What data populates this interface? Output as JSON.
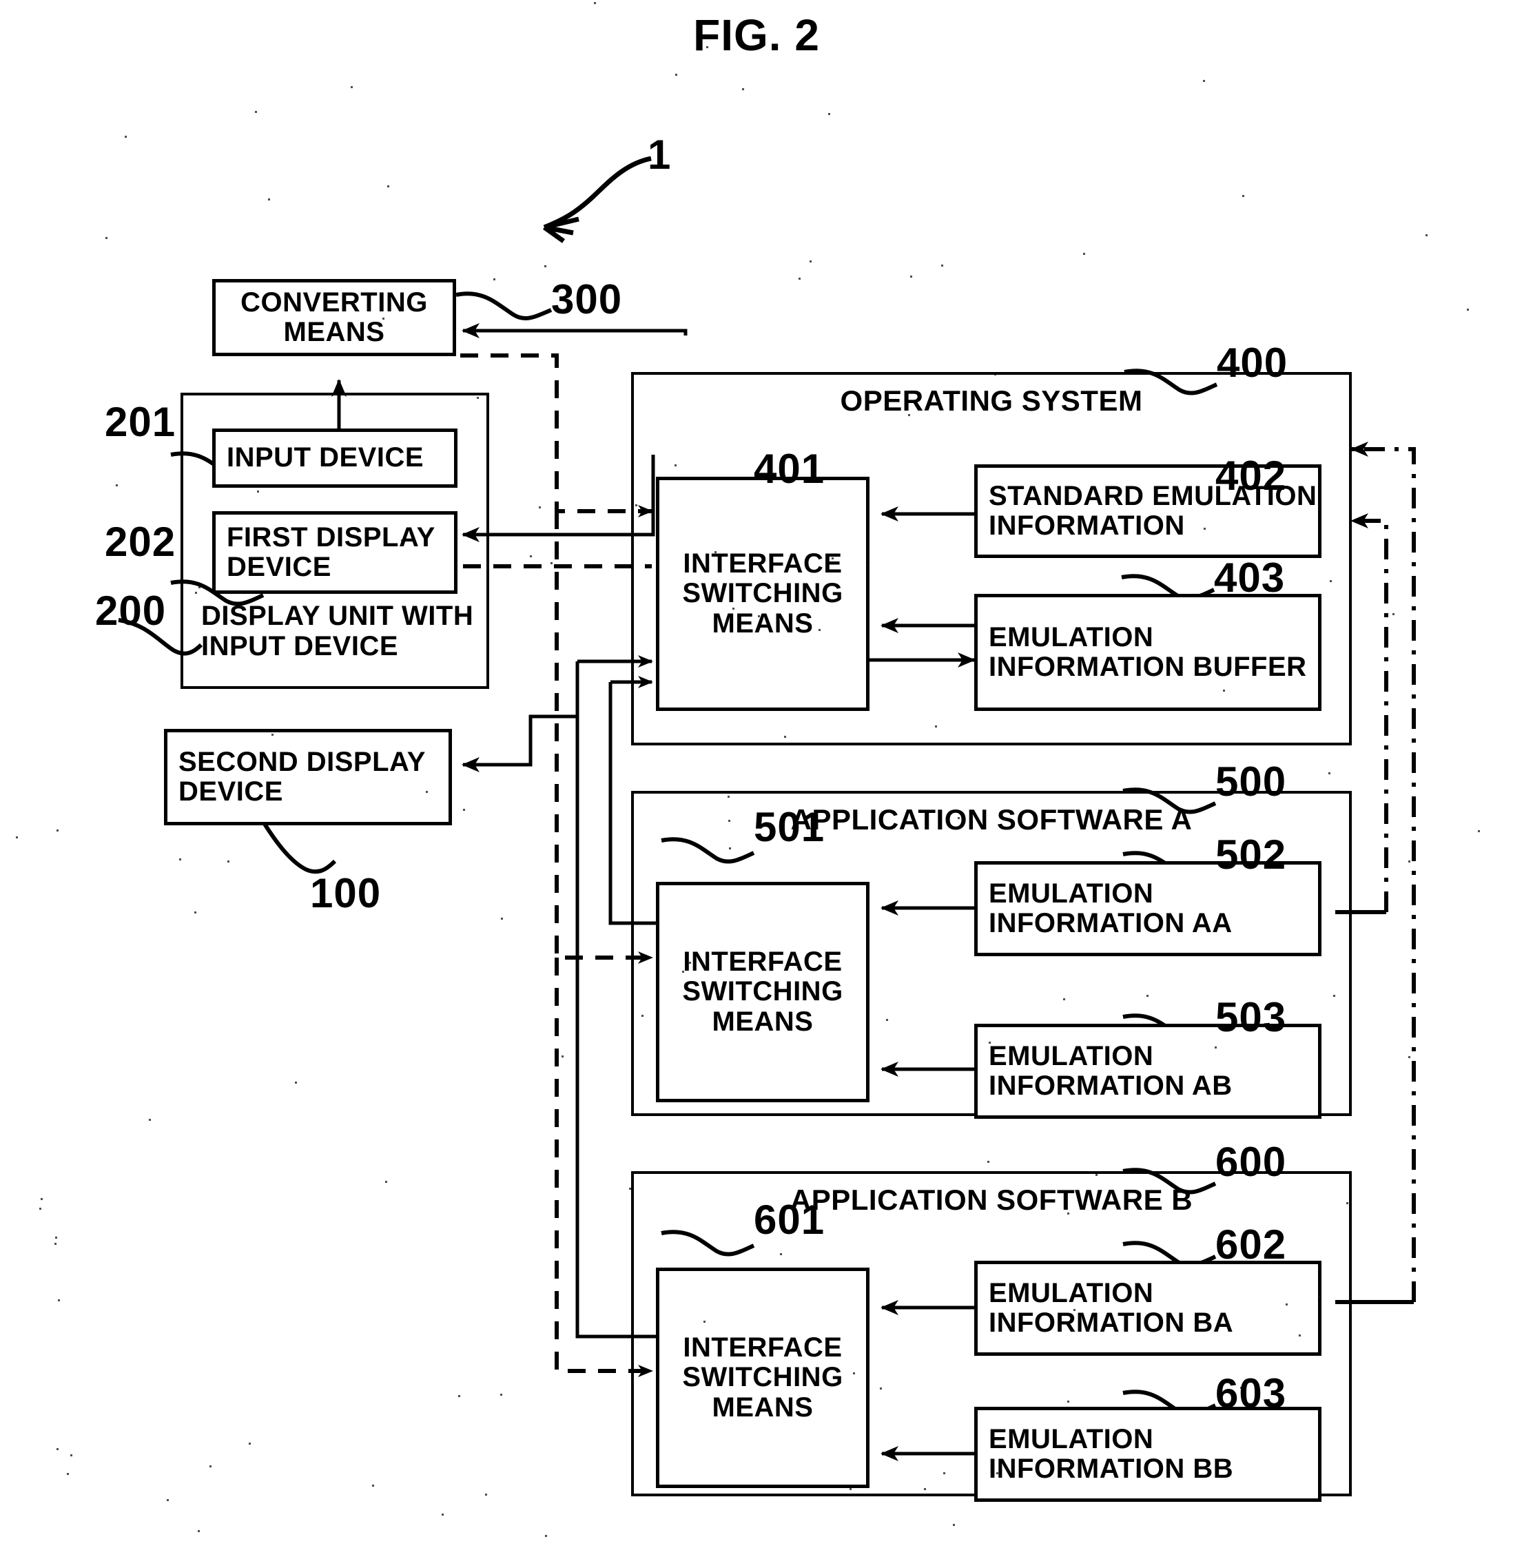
{
  "figure": {
    "title": "FIG. 2",
    "system_ref": "1"
  },
  "left_column": {
    "converting_means": {
      "label": "CONVERTING\nMEANS",
      "ref": "300"
    },
    "display_unit": {
      "label": "DISPLAY UNIT WITH\nINPUT DEVICE",
      "ref": "200",
      "children": [
        {
          "label": "INPUT DEVICE",
          "ref": "201"
        },
        {
          "label": "FIRST DISPLAY\nDEVICE",
          "ref": "202"
        }
      ]
    },
    "second_display_device": {
      "label": "SECOND DISPLAY\nDEVICE",
      "ref": "100"
    }
  },
  "operating_system": {
    "title": "OPERATING SYSTEM",
    "ref": "400",
    "interface_switching_means": {
      "label": "INTERFACE\nSWITCHING\nMEANS",
      "ref": "401"
    },
    "standard_emulation_information": {
      "label": "STANDARD EMULATION\nINFORMATION",
      "ref": "402"
    },
    "emulation_information_buffer": {
      "label": "EMULATION\nINFORMATION BUFFER",
      "ref": "403"
    }
  },
  "application_software_a": {
    "title": "APPLICATION SOFTWARE A",
    "ref": "500",
    "interface_switching_means": {
      "label": "INTERFACE\nSWITCHING\nMEANS",
      "ref": "501"
    },
    "emulation_information_aa": {
      "label": "EMULATION\nINFORMATION AA",
      "ref": "502"
    },
    "emulation_information_ab": {
      "label": "EMULATION\nINFORMATION AB",
      "ref": "503"
    }
  },
  "application_software_b": {
    "title": "APPLICATION SOFTWARE B",
    "ref": "600",
    "interface_switching_means": {
      "label": "INTERFACE\nSWITCHING\nMEANS",
      "ref": "601"
    },
    "emulation_information_ba": {
      "label": "EMULATION\nINFORMATION BA",
      "ref": "602"
    },
    "emulation_information_bb": {
      "label": "EMULATION\nINFORMATION BB",
      "ref": "603"
    }
  }
}
